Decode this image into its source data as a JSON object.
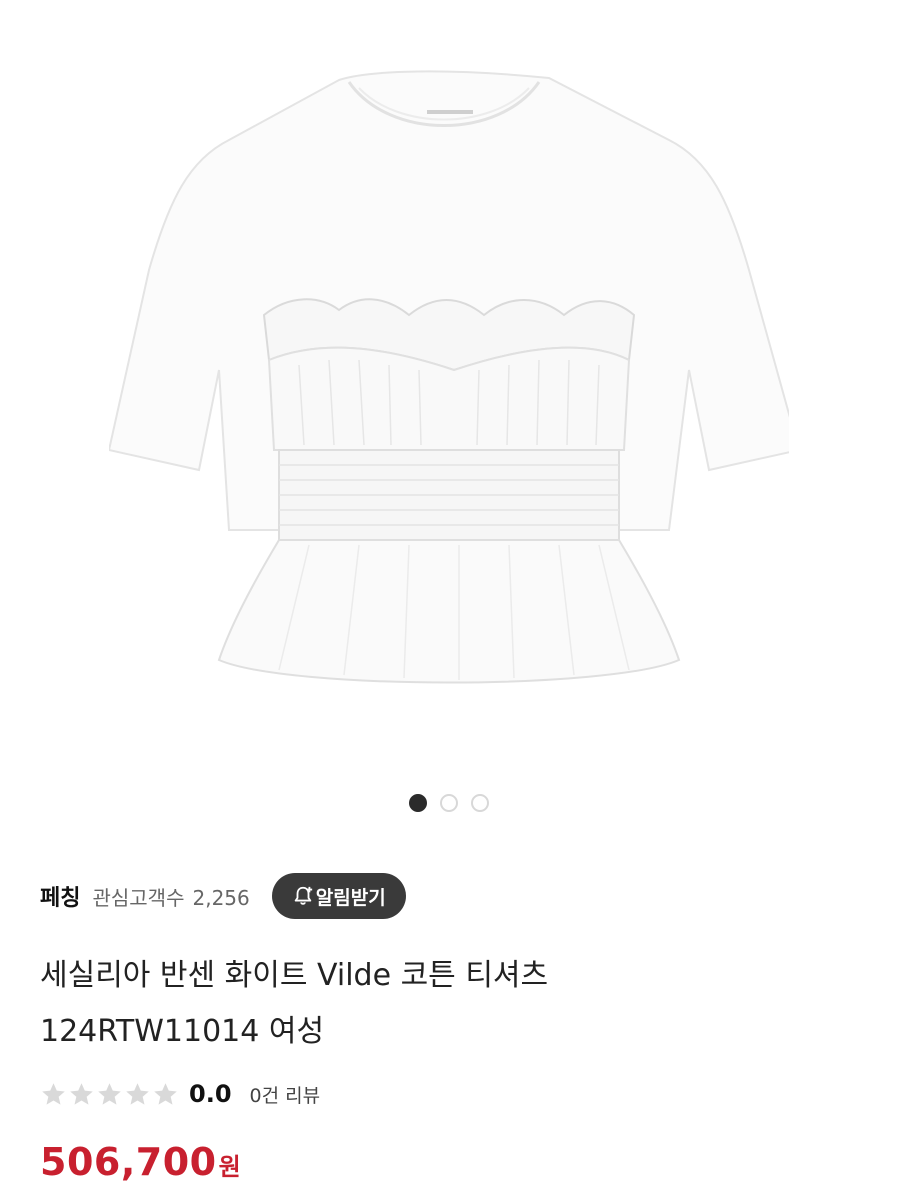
{
  "product": {
    "image_alt": "white short-sleeve t-shirt with ruched bustier overlay",
    "gallery": {
      "total": 3,
      "active_index": 0
    },
    "brand": "페칭",
    "watchers_label": "관심고객수",
    "watchers_count": "2,256",
    "alert_button_label": "알림받기",
    "title_line1": "세실리아 반센 화이트 Vilde 코튼 티셔츠",
    "title_line2": "124RTW11014 여성",
    "rating": {
      "value": "0.0",
      "stars_filled": 0,
      "stars_total": 5
    },
    "review_count_text": "0건 리뷰",
    "price": "506,700",
    "currency": "원"
  },
  "colors": {
    "price": "#c8202f",
    "alert_button_bg": "#3a3a3a",
    "star_empty": "#d9d9d9",
    "dot_active": "#2b2b2b"
  },
  "icons": {
    "alert": "bell-plus-icon",
    "rating": "star-icon"
  }
}
